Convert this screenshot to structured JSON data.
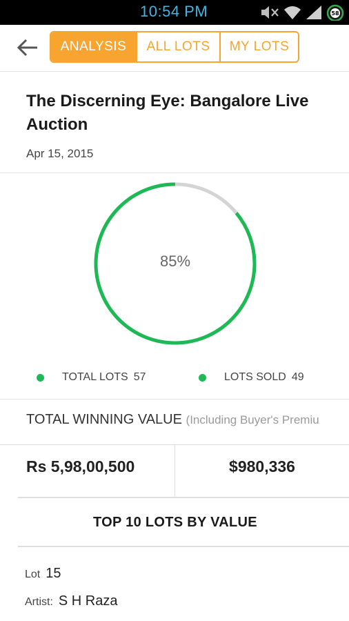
{
  "status_bar": {
    "time": "10:54 PM",
    "icons": [
      "mute-icon",
      "wifi-icon",
      "signal-icon",
      "battery-icon"
    ],
    "battery_text": "58"
  },
  "header": {
    "back_icon": "arrow-left-icon",
    "tabs": [
      {
        "label": "ANALYSIS",
        "active": true
      },
      {
        "label": "ALL LOTS",
        "active": false
      },
      {
        "label": "MY LOTS",
        "active": false
      }
    ]
  },
  "auction": {
    "title": "The Discerning Eye: Bangalore Live Auction",
    "date": "Apr 15, 2015"
  },
  "sold_chart": {
    "percent_label": "85%",
    "fraction_sold": 0.86,
    "colors": {
      "sold": "#1db954",
      "remaining": "#d4d4d4"
    }
  },
  "legend": [
    {
      "label": "TOTAL LOTS",
      "value": "57"
    },
    {
      "label": "LOTS SOLD",
      "value": "49"
    }
  ],
  "winning": {
    "label": "TOTAL WINNING VALUE",
    "note": "(Including Buyer's Premiu",
    "value_inr": "Rs 5,98,00,500",
    "value_usd": "$980,336"
  },
  "top_lots": {
    "heading": "TOP 10 LOTS BY VALUE",
    "lot_key": "Lot",
    "lot_value": "15",
    "artist_key": "Artist:",
    "artist_value": "S H Raza"
  },
  "colors": {
    "accent": "#f7a530",
    "green": "#1db954"
  }
}
